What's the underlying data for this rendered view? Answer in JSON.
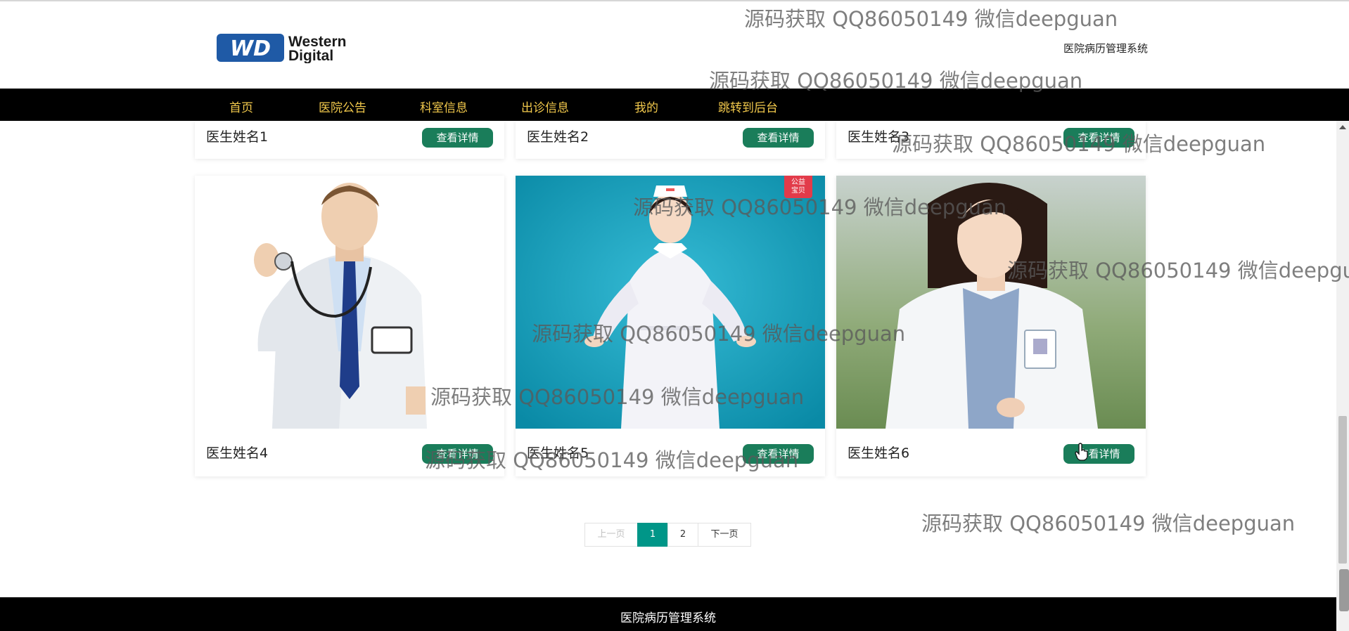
{
  "header": {
    "logo_alt": "Western Digital",
    "logo_word1": "Western",
    "logo_word2": "Digital",
    "logo_mark": "WD",
    "site_title": "医院病历管理系统"
  },
  "nav": {
    "items": [
      {
        "label": "首页"
      },
      {
        "label": "医院公告"
      },
      {
        "label": "科室信息"
      },
      {
        "label": "出诊信息"
      },
      {
        "label": "我的"
      },
      {
        "label": "跳转到后台"
      }
    ],
    "color": "#f2c94c"
  },
  "doctors": [
    {
      "name": "医生姓名1",
      "button": "查看详情"
    },
    {
      "name": "医生姓名2",
      "button": "查看详情"
    },
    {
      "name": "医生姓名3",
      "button": "查看详情"
    },
    {
      "name": "医生姓名4",
      "button": "查看详情",
      "photo": "male doctor with stethoscope"
    },
    {
      "name": "医生姓名5",
      "button": "查看详情",
      "photo": "nurse on teal background",
      "badge": "公益宝贝"
    },
    {
      "name": "医生姓名6",
      "button": "查看详情",
      "photo": "female doctor outdoors"
    }
  ],
  "pagination": {
    "prev": "上一页",
    "pages": [
      "1",
      "2"
    ],
    "current": "1",
    "next": "下一页"
  },
  "footer": {
    "text": "医院病历管理系统"
  },
  "watermark": {
    "text": "源码获取 QQ86050149 微信deepguan"
  },
  "colors": {
    "button": "#1a7d5a",
    "active_page": "#009688",
    "navbar": "#000000"
  }
}
